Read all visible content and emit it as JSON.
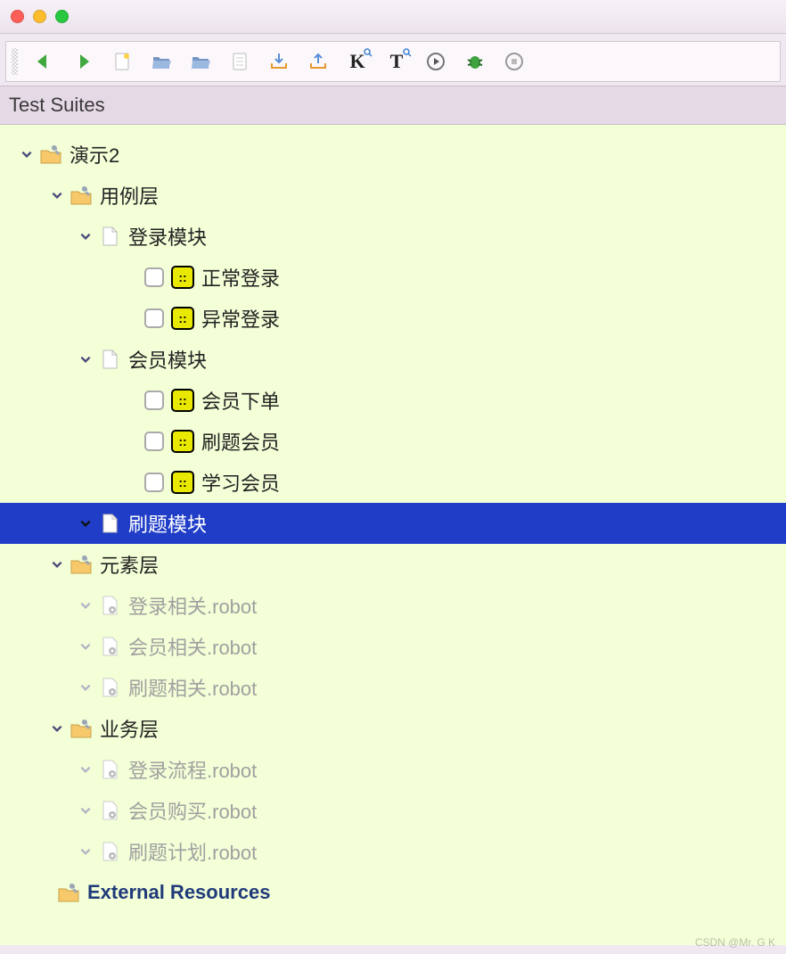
{
  "panel": {
    "title": "Test Suites"
  },
  "toolbar": {
    "icons": [
      "back",
      "forward",
      "new-file",
      "open-folder",
      "open-folder-alt",
      "document",
      "import",
      "export",
      "search-keyword",
      "search-text",
      "run",
      "debug",
      "stop"
    ]
  },
  "tree": {
    "root": {
      "label": "演示2",
      "children": [
        {
          "label": "用例层",
          "type": "folder",
          "children": [
            {
              "label": "登录模块",
              "type": "file",
              "tests": [
                {
                  "label": "正常登录"
                },
                {
                  "label": "异常登录"
                }
              ]
            },
            {
              "label": "会员模块",
              "type": "file",
              "tests": [
                {
                  "label": "会员下单"
                },
                {
                  "label": "刷题会员"
                },
                {
                  "label": "学习会员"
                }
              ]
            },
            {
              "label": "刷题模块",
              "type": "file",
              "tests": [],
              "selected": true
            }
          ]
        },
        {
          "label": "元素层",
          "type": "folder",
          "children": [
            {
              "label": "登录相关.robot",
              "type": "resource"
            },
            {
              "label": "会员相关.robot",
              "type": "resource"
            },
            {
              "label": "刷题相关.robot",
              "type": "resource"
            }
          ]
        },
        {
          "label": "业务层",
          "type": "folder",
          "children": [
            {
              "label": "登录流程.robot",
              "type": "resource"
            },
            {
              "label": "会员购买.robot",
              "type": "resource"
            },
            {
              "label": "刷题计划.robot",
              "type": "resource"
            }
          ]
        }
      ]
    },
    "external": {
      "label": "External Resources"
    }
  },
  "watermark": "CSDN @Mr. G K"
}
